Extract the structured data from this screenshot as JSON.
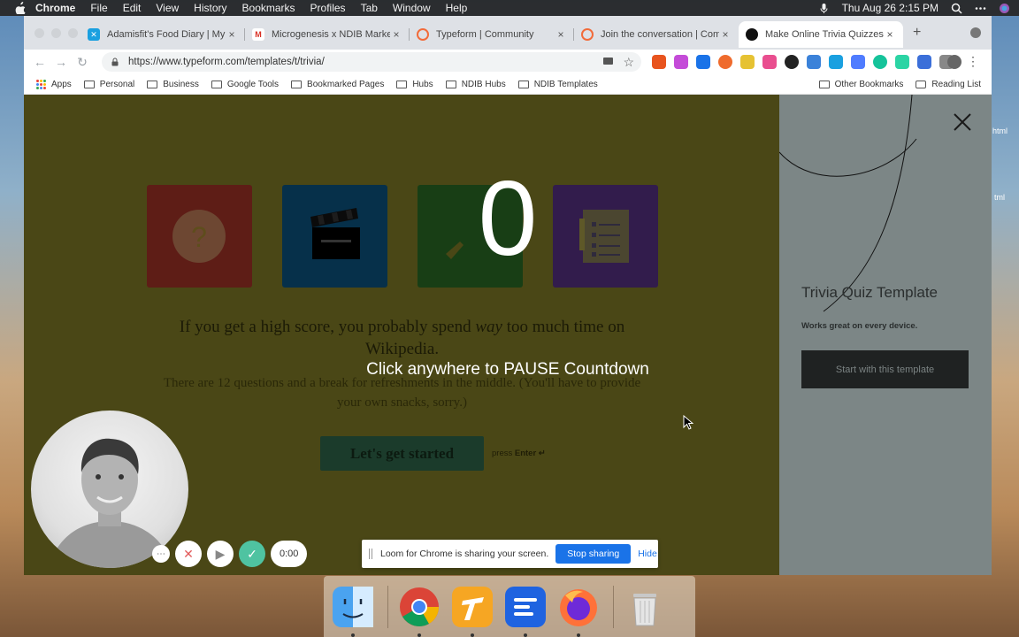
{
  "menubar": {
    "items": [
      "Chrome",
      "File",
      "Edit",
      "View",
      "History",
      "Bookmarks",
      "Profiles",
      "Tab",
      "Window",
      "Help"
    ],
    "clock": "Thu Aug 26  2:15 PM"
  },
  "browser": {
    "tabs": [
      {
        "title": "Adamisfit's Food Diary | MyFitnessPal",
        "favicon_color": "#1aa0e0"
      },
      {
        "title": "Microgenesis x NDIB Marketing",
        "favicon_color": "#d93025"
      },
      {
        "title": "Typeform | Community",
        "favicon_color": "#f26b3a"
      },
      {
        "title": "Join the conversation | Community",
        "favicon_color": "#f26b3a"
      },
      {
        "title": "Make Online Trivia Quizzes—Free",
        "favicon_color": "#111111"
      }
    ],
    "url": "https://www.typeform.com/templates/t/trivia/",
    "bookmarks": [
      "Apps",
      "Personal",
      "Business",
      "Google Tools",
      "Bookmarked Pages",
      "Hubs",
      "NDIB Hubs",
      "NDIB Templates"
    ],
    "bookmarks_right": [
      "Other Bookmarks",
      "Reading List"
    ]
  },
  "page": {
    "headline_pre": "If you get a high score, you probably spend ",
    "headline_em": "way",
    "headline_post": " too much time on Wikipedia.",
    "subline": "There are 12 questions and a break for refreshments in the middle. (You'll have to provide your own snacks, sorry.)",
    "cta_label": "Let's get started",
    "press_label": "press",
    "enter_label": "Enter ↵",
    "panel_title": "Trivia Quiz Template",
    "panel_sub": "Works great on every device.",
    "panel_button": "Start with this template",
    "card_glyph": "?"
  },
  "overlay": {
    "countdown": "0",
    "message": "Click anywhere to PAUSE Countdown"
  },
  "loom": {
    "timer": "0:00",
    "share_message": "Loom for Chrome is sharing your screen.",
    "stop_label": "Stop sharing",
    "hide_label": "Hide"
  },
  "desktop": {
    "labels": [
      "html",
      "tml"
    ]
  },
  "colors": {
    "stage_bg": "#4a4716",
    "panel_bg": "#7c8686",
    "accent": "#1a73e8",
    "loom_green": "#4fc3a1"
  }
}
